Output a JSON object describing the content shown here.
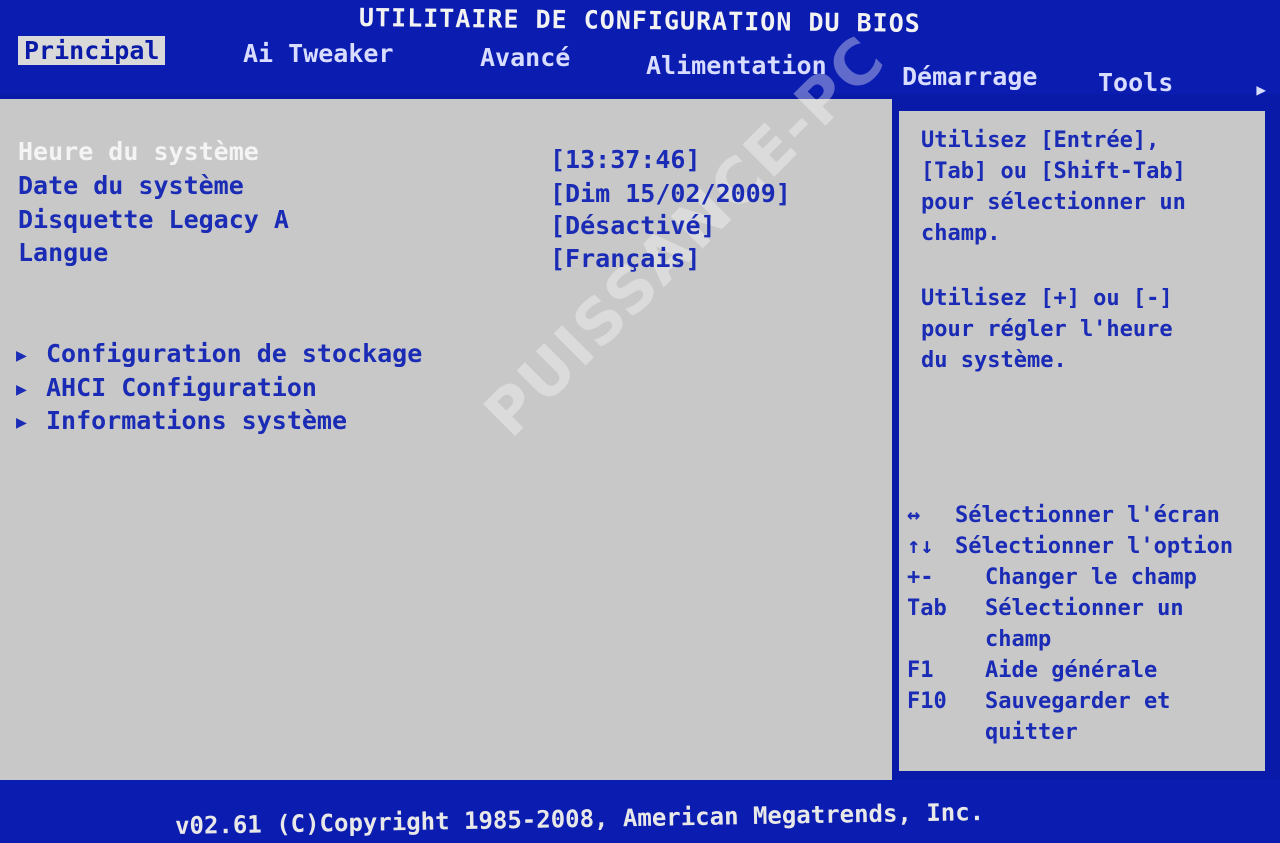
{
  "title": "UTILITAIRE DE CONFIGURATION DU BIOS",
  "tabs": [
    {
      "label": "Principal",
      "active": true
    },
    {
      "label": "Ai Tweaker",
      "active": false
    },
    {
      "label": "Avancé",
      "active": false
    },
    {
      "label": "Alimentation",
      "active": false
    },
    {
      "label": "Démarrage",
      "active": false
    },
    {
      "label": "Tools",
      "active": false
    }
  ],
  "tab_more_icon": "right-arrow-icon",
  "settings": [
    {
      "label": "Heure du système",
      "value": "[13:37:46]",
      "selected": true
    },
    {
      "label": "Date du système",
      "value": "[Dim 15/02/2009]",
      "selected": false
    },
    {
      "label": "Disquette Legacy A",
      "value": "[Désactivé]",
      "selected": false
    },
    {
      "label": "Langue",
      "value": "[Français]",
      "selected": false
    }
  ],
  "submenus": [
    {
      "label": "Configuration de stockage",
      "icon": "triangle-right-icon"
    },
    {
      "label": "AHCI Configuration",
      "icon": "triangle-right-icon"
    },
    {
      "label": "Informations système",
      "icon": "triangle-right-icon"
    }
  ],
  "help": {
    "text1": "Utilisez [Entrée],\n[Tab] ou [Shift-Tab]\npour sélectionner un\nchamp.",
    "text2": "Utilisez [+] ou [-]\npour régler l'heure\ndu système."
  },
  "keys": [
    {
      "key": "↔",
      "desc": "Sélectionner l'écran"
    },
    {
      "key": "↑↓",
      "desc": "Sélectionner l'option"
    },
    {
      "key": "+-",
      "desc": "Changer le champ"
    },
    {
      "key": "Tab",
      "desc": "Sélectionner un"
    },
    {
      "key": "",
      "desc": "champ"
    },
    {
      "key": "F1",
      "desc": "Aide générale"
    },
    {
      "key": "F10",
      "desc": "Sauvegarder et"
    },
    {
      "key": "",
      "desc": "quitter"
    }
  ],
  "watermark": "PUISSANCE-PC",
  "footer": "v02.61 (C)Copyright 1985-2008, American Megatrends, Inc.",
  "colors": {
    "background": "#0a1aa8",
    "panel": "#c8c8c8",
    "text_blue": "#1a2bb5",
    "text_white": "#f4f4f4"
  }
}
